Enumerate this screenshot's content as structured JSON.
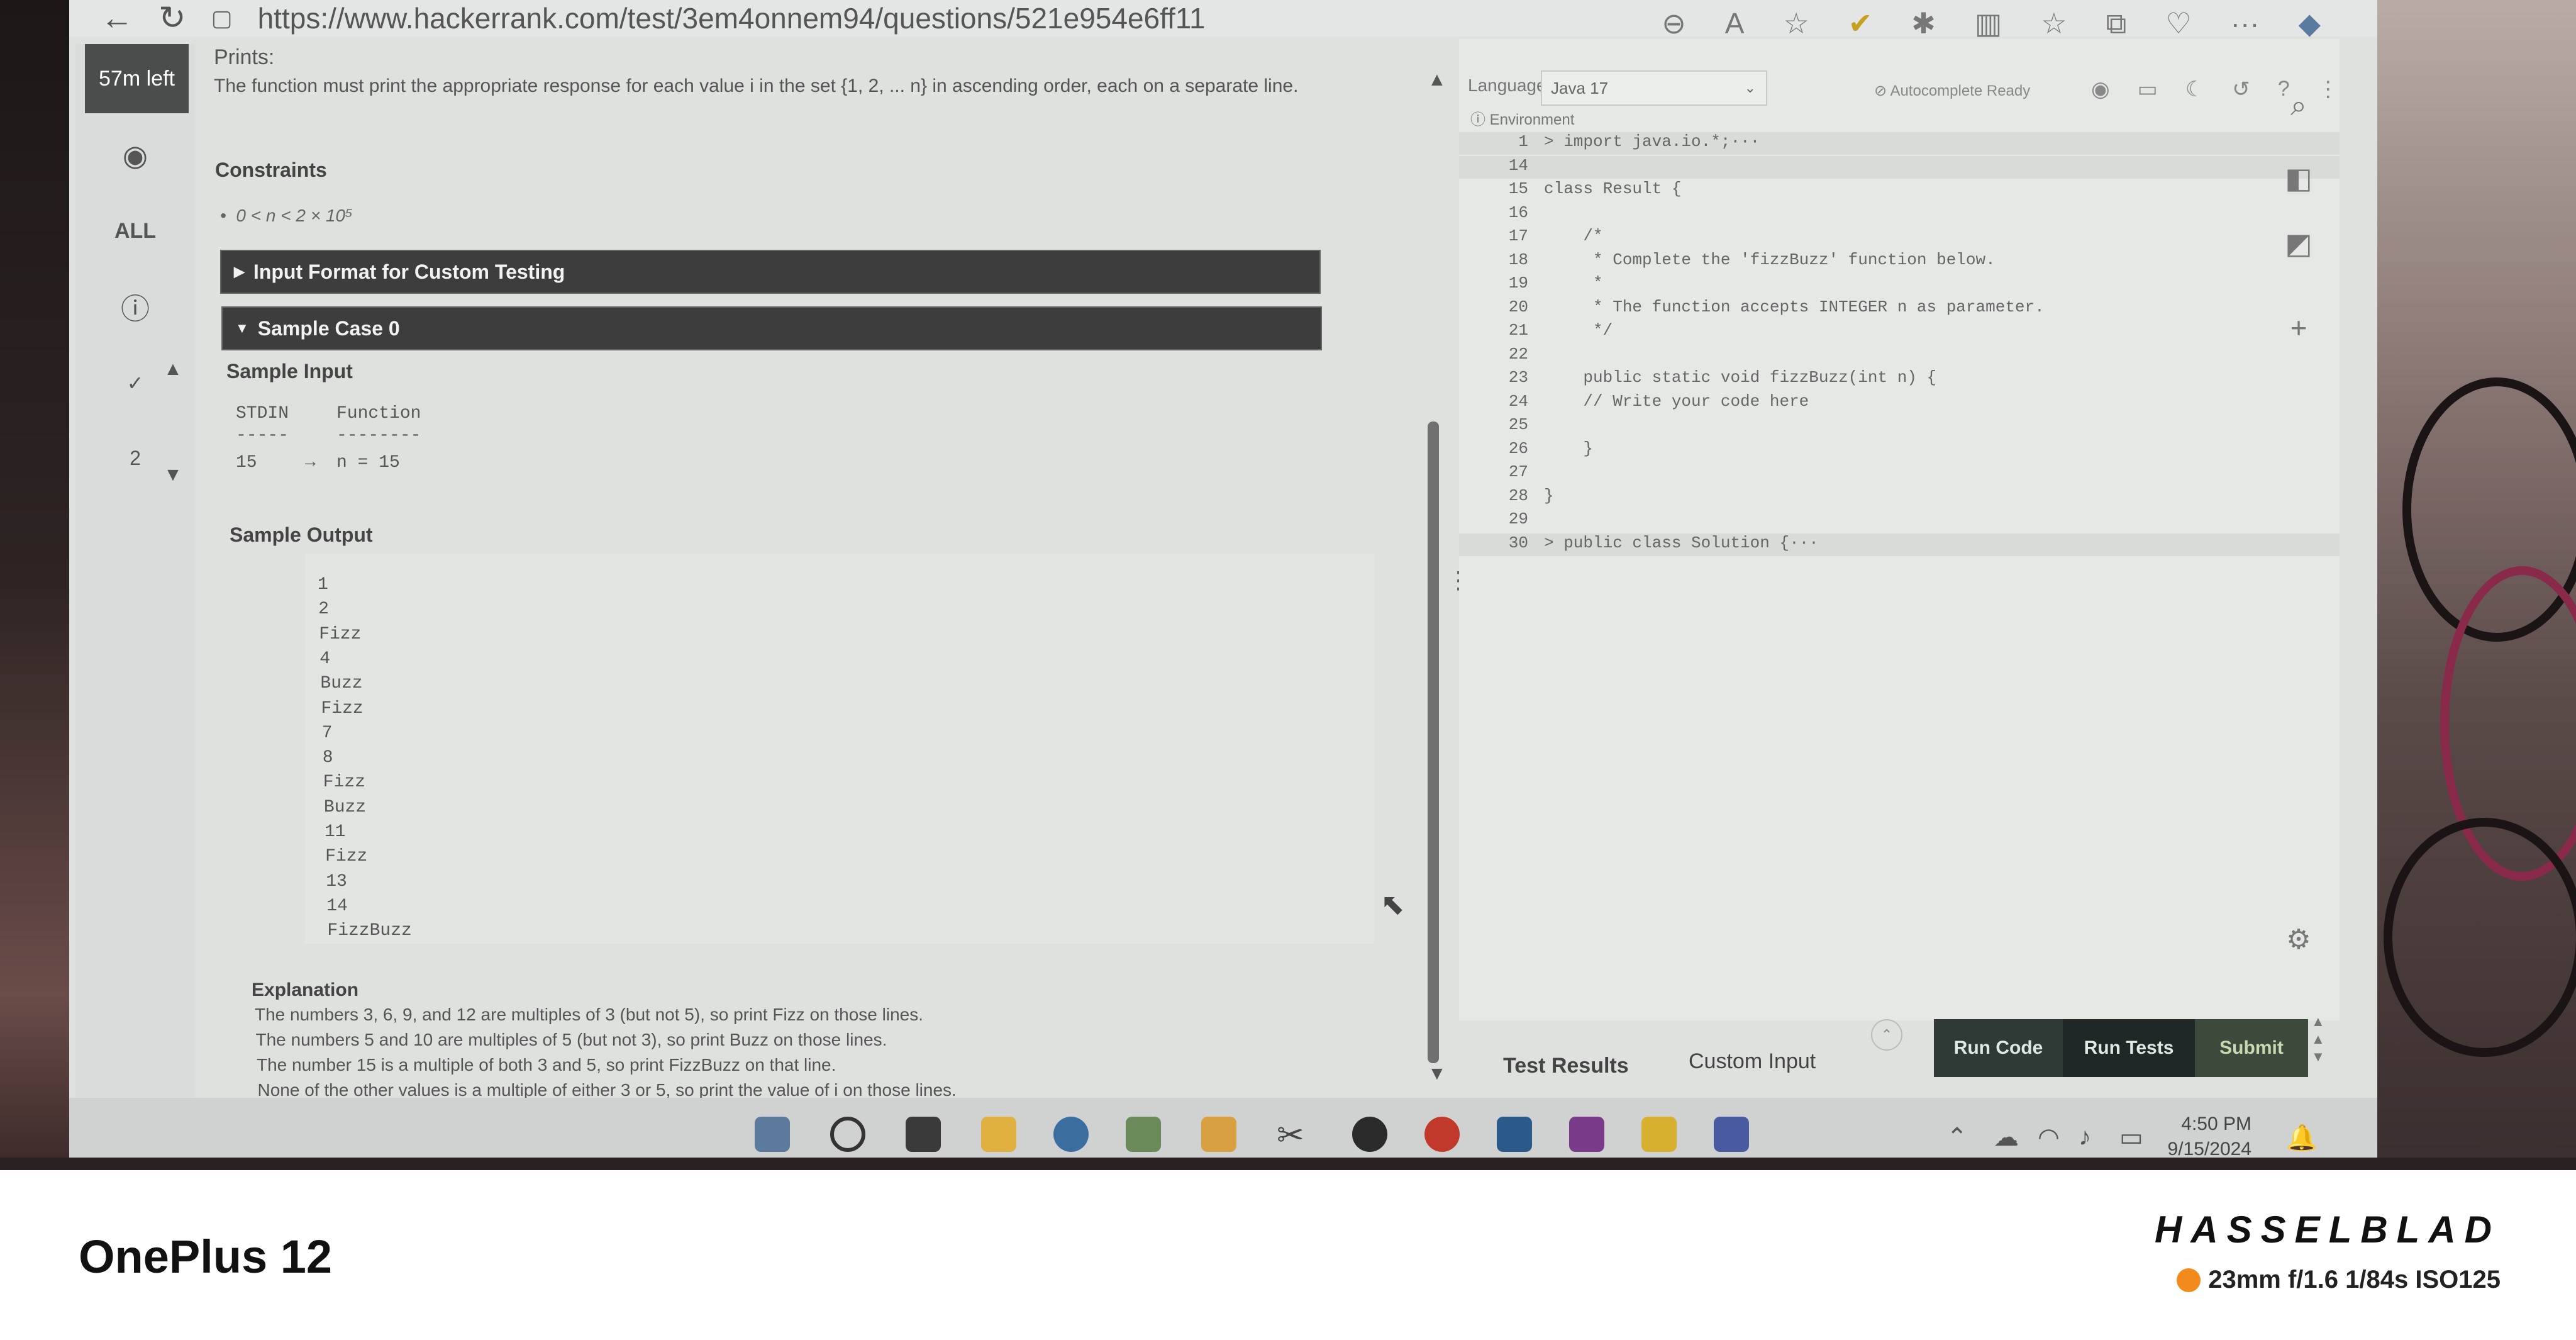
{
  "browser": {
    "url": "https://www.hackerrank.com/test/3em4onnem94/questions/521e954e6ff11"
  },
  "rail": {
    "time_left": "57m left",
    "all_label": "ALL",
    "question_number": "2"
  },
  "problem": {
    "prints_label": "Prints:",
    "prints_desc": "The function must print the appropriate response for each value i in the set {1, 2, ... n} in ascending order, each on a separate line.",
    "constraints_heading": "Constraints",
    "constraint": "0 < n < 2 × 10⁵",
    "input_format_bar": "Input Format for Custom Testing",
    "sample_case_bar": "Sample Case 0",
    "sample_input_heading": "Sample Input",
    "stdin_header": "STDIN",
    "function_header": "Function",
    "stdin_dashes": "-----",
    "function_dashes": "--------",
    "stdin_value": "15",
    "arrow": "→",
    "function_value": "n = 15",
    "sample_output_heading": "Sample Output",
    "sample_output": [
      "1",
      "2",
      "Fizz",
      "4",
      "Buzz",
      "Fizz",
      "7",
      "8",
      "Fizz",
      "Buzz",
      "11",
      "Fizz",
      "13",
      "14",
      "FizzBuzz"
    ],
    "explanation_heading": "Explanation",
    "explanation": [
      "The numbers 3, 6, 9, and 12 are multiples of 3 (but not 5), so print Fizz on those lines.",
      "The numbers 5 and 10 are multiples of 5 (but not 3), so print Buzz on those lines.",
      "The number 15 is a multiple of both 3 and 5, so print FizzBuzz on that line.",
      "None of the other values is a multiple of either 3 or 5, so print the value of i on those lines."
    ]
  },
  "editor": {
    "language_label": "Language",
    "language_value": "Java 17",
    "environment_label": "Environment",
    "autocomplete": "Autocomplete Ready",
    "code_lines": [
      {
        "n": "1",
        "t": "> import java.io.*;···",
        "hl": true
      },
      {
        "n": "14",
        "t": "",
        "hl": true
      },
      {
        "n": "15",
        "t": "class Result {",
        "hl": false
      },
      {
        "n": "16",
        "t": "",
        "hl": false
      },
      {
        "n": "17",
        "t": "    /*",
        "hl": false
      },
      {
        "n": "18",
        "t": "     * Complete the 'fizzBuzz' function below.",
        "hl": false
      },
      {
        "n": "19",
        "t": "     *",
        "hl": false
      },
      {
        "n": "20",
        "t": "     * The function accepts INTEGER n as parameter.",
        "hl": false
      },
      {
        "n": "21",
        "t": "     */",
        "hl": false
      },
      {
        "n": "22",
        "t": "",
        "hl": false
      },
      {
        "n": "23",
        "t": "    public static void fizzBuzz(int n) {",
        "hl": false
      },
      {
        "n": "24",
        "t": "    // Write your code here",
        "hl": false
      },
      {
        "n": "25",
        "t": "",
        "hl": false
      },
      {
        "n": "26",
        "t": "    }",
        "hl": false
      },
      {
        "n": "27",
        "t": "",
        "hl": false
      },
      {
        "n": "28",
        "t": "}",
        "hl": false
      },
      {
        "n": "29",
        "t": "",
        "hl": false
      },
      {
        "n": "30",
        "t": "> public class Solution {···",
        "hl": true
      }
    ],
    "test_results_tab": "Test Results",
    "custom_input_tab": "Custom Input",
    "run_code": "Run Code",
    "run_tests": "Run Tests",
    "submit": "Submit"
  },
  "taskbar": {
    "time": "4:50 PM",
    "date": "9/15/2024"
  },
  "footer": {
    "phone_model": "OnePlus 12",
    "camera_brand": "HASSELBLAD",
    "specs": "23mm  f/1.6  1/84s  ISO125",
    "accent_color": "#f28a1c"
  }
}
